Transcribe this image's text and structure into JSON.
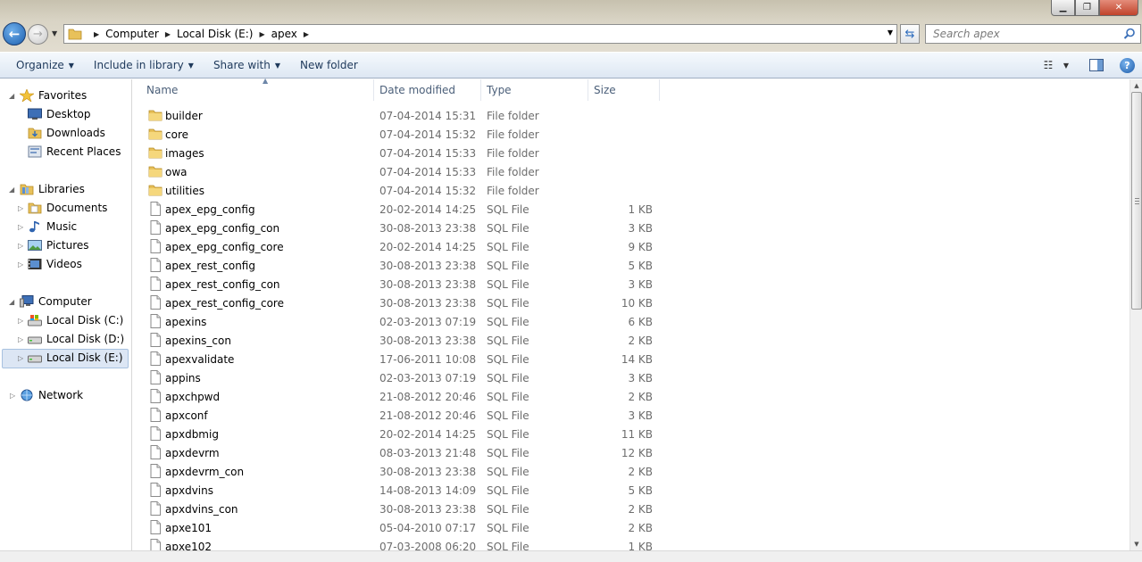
{
  "window": {
    "min_icon": "minimize-icon",
    "max_icon": "maximize-icon",
    "close_icon": "close-icon"
  },
  "address": {
    "crumbs": [
      "Computer",
      "Local Disk (E:)",
      "apex"
    ]
  },
  "search": {
    "placeholder": "Search apex"
  },
  "toolbar": {
    "organize": "Organize",
    "include_in_library": "Include in library",
    "share_with": "Share with",
    "new_folder": "New folder"
  },
  "nav": {
    "favorites": "Favorites",
    "desktop": "Desktop",
    "downloads": "Downloads",
    "recent_places": "Recent Places",
    "libraries": "Libraries",
    "documents": "Documents",
    "music": "Music",
    "pictures": "Pictures",
    "videos": "Videos",
    "computer": "Computer",
    "disk_c": "Local Disk (C:)",
    "disk_d": "Local Disk (D:)",
    "disk_e": "Local Disk (E:)",
    "network": "Network"
  },
  "columns": {
    "name": "Name",
    "date": "Date modified",
    "type": "Type",
    "size": "Size"
  },
  "files": [
    {
      "name": "builder",
      "date": "07-04-2014 15:31",
      "type": "File folder",
      "size": "",
      "kind": "folder"
    },
    {
      "name": "core",
      "date": "07-04-2014 15:32",
      "type": "File folder",
      "size": "",
      "kind": "folder"
    },
    {
      "name": "images",
      "date": "07-04-2014 15:33",
      "type": "File folder",
      "size": "",
      "kind": "folder"
    },
    {
      "name": "owa",
      "date": "07-04-2014 15:33",
      "type": "File folder",
      "size": "",
      "kind": "folder"
    },
    {
      "name": "utilities",
      "date": "07-04-2014 15:32",
      "type": "File folder",
      "size": "",
      "kind": "folder"
    },
    {
      "name": "apex_epg_config",
      "date": "20-02-2014 14:25",
      "type": "SQL File",
      "size": "1 KB",
      "kind": "file"
    },
    {
      "name": "apex_epg_config_con",
      "date": "30-08-2013 23:38",
      "type": "SQL File",
      "size": "3 KB",
      "kind": "file"
    },
    {
      "name": "apex_epg_config_core",
      "date": "20-02-2014 14:25",
      "type": "SQL File",
      "size": "9 KB",
      "kind": "file"
    },
    {
      "name": "apex_rest_config",
      "date": "30-08-2013 23:38",
      "type": "SQL File",
      "size": "5 KB",
      "kind": "file"
    },
    {
      "name": "apex_rest_config_con",
      "date": "30-08-2013 23:38",
      "type": "SQL File",
      "size": "3 KB",
      "kind": "file"
    },
    {
      "name": "apex_rest_config_core",
      "date": "30-08-2013 23:38",
      "type": "SQL File",
      "size": "10 KB",
      "kind": "file"
    },
    {
      "name": "apexins",
      "date": "02-03-2013 07:19",
      "type": "SQL File",
      "size": "6 KB",
      "kind": "file"
    },
    {
      "name": "apexins_con",
      "date": "30-08-2013 23:38",
      "type": "SQL File",
      "size": "2 KB",
      "kind": "file"
    },
    {
      "name": "apexvalidate",
      "date": "17-06-2011 10:08",
      "type": "SQL File",
      "size": "14 KB",
      "kind": "file"
    },
    {
      "name": "appins",
      "date": "02-03-2013 07:19",
      "type": "SQL File",
      "size": "3 KB",
      "kind": "file"
    },
    {
      "name": "apxchpwd",
      "date": "21-08-2012 20:46",
      "type": "SQL File",
      "size": "2 KB",
      "kind": "file"
    },
    {
      "name": "apxconf",
      "date": "21-08-2012 20:46",
      "type": "SQL File",
      "size": "3 KB",
      "kind": "file"
    },
    {
      "name": "apxdbmig",
      "date": "20-02-2014 14:25",
      "type": "SQL File",
      "size": "11 KB",
      "kind": "file"
    },
    {
      "name": "apxdevrm",
      "date": "08-03-2013 21:48",
      "type": "SQL File",
      "size": "12 KB",
      "kind": "file"
    },
    {
      "name": "apxdevrm_con",
      "date": "30-08-2013 23:38",
      "type": "SQL File",
      "size": "2 KB",
      "kind": "file"
    },
    {
      "name": "apxdvins",
      "date": "14-08-2013 14:09",
      "type": "SQL File",
      "size": "5 KB",
      "kind": "file"
    },
    {
      "name": "apxdvins_con",
      "date": "30-08-2013 23:38",
      "type": "SQL File",
      "size": "2 KB",
      "kind": "file"
    },
    {
      "name": "apxe101",
      "date": "05-04-2010 07:17",
      "type": "SQL File",
      "size": "2 KB",
      "kind": "file"
    },
    {
      "name": "apxe102",
      "date": "07-03-2008 06:20",
      "type": "SQL File",
      "size": "1 KB",
      "kind": "file"
    }
  ]
}
